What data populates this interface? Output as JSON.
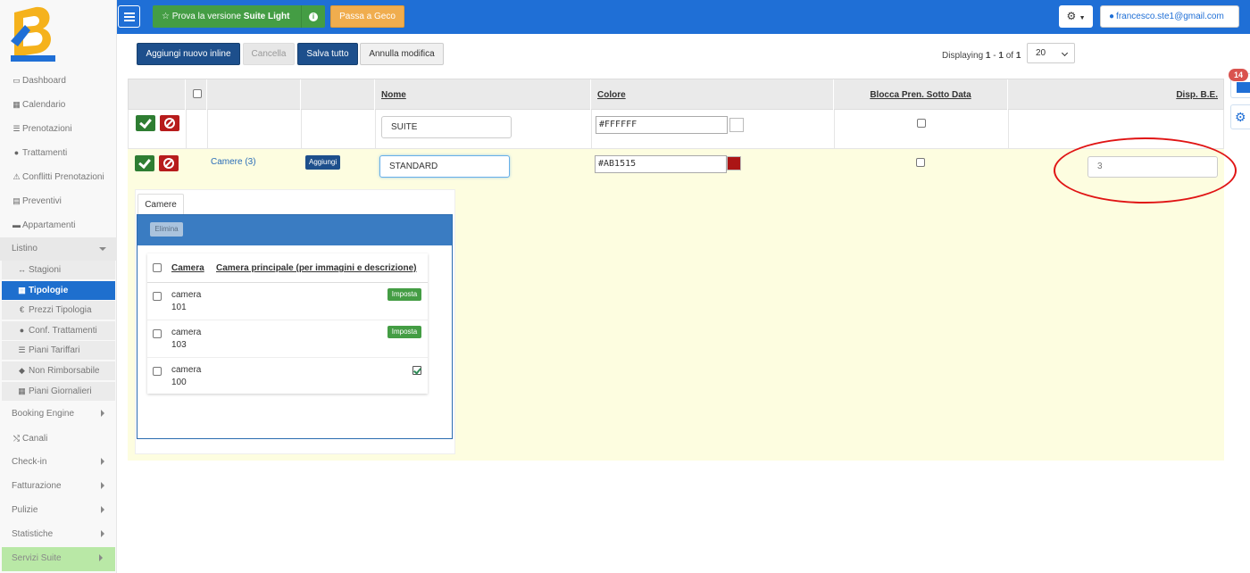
{
  "topbar": {
    "light_prefix": "Prova la versione",
    "light_bold": "Suite Light",
    "geco_label": "Passa a Geco",
    "user_email": "francesco.ste1@gmail.com"
  },
  "sidebar": {
    "items": [
      {
        "label": "Dashboard",
        "icon": "monitor-icon"
      },
      {
        "label": "Calendario",
        "icon": "calendar-icon"
      },
      {
        "label": "Prenotazioni",
        "icon": "list-icon"
      },
      {
        "label": "Trattamenti",
        "icon": "apple-icon"
      },
      {
        "label": "Conflitti Prenotazioni",
        "icon": "warning-icon"
      },
      {
        "label": "Preventivi",
        "icon": "document-icon"
      },
      {
        "label": "Appartamenti",
        "icon": "bed-icon"
      }
    ],
    "listino": "Listino",
    "sub_items": [
      {
        "label": "Stagioni"
      },
      {
        "label": "Tipologie"
      },
      {
        "label": "Prezzi Tipologia"
      },
      {
        "label": "Conf. Trattamenti"
      },
      {
        "label": "Piani Tariffari"
      },
      {
        "label": "Non Rimborsabile"
      },
      {
        "label": "Piani Giornalieri"
      }
    ],
    "bottom_items": [
      {
        "label": "Booking Engine"
      },
      {
        "label": "Canali"
      },
      {
        "label": "Check-in"
      },
      {
        "label": "Fatturazione"
      },
      {
        "label": "Pulizie"
      },
      {
        "label": "Statistiche"
      },
      {
        "label": "Servizi Suite"
      }
    ]
  },
  "toolbar": {
    "add_inline": "Aggiungi nuovo inline",
    "cancel": "Cancella",
    "save_all": "Salva tutto",
    "undo": "Annulla modifica",
    "displaying_prefix": "Displaying",
    "range_start": "1",
    "range_sep": "-",
    "range_end": "1",
    "of_label": "of",
    "total": "1",
    "page_size": "20"
  },
  "table": {
    "headers": {
      "nome": "Nome",
      "colore": "Colore",
      "blocca": "Blocca Pren. Sotto Data",
      "disp": "Disp. B.E."
    },
    "rows": [
      {
        "nome": "SUITE",
        "colore": "#FFFFFF",
        "swatch": "#FFFFFF",
        "disp": ""
      },
      {
        "nome": "STANDARD",
        "colore": "#AB1515",
        "swatch": "#AB1515",
        "camere_link": "Camere (3)",
        "aggiungi": "Aggiungi",
        "disp": "3"
      }
    ]
  },
  "subpanel": {
    "tab": "Camere",
    "elimina": "Elimina",
    "col_camera": "Camera",
    "col_principale": "Camera principale (per immagini e descrizione)",
    "rows": [
      {
        "line1": "camera",
        "line2": "101",
        "action": "Imposta"
      },
      {
        "line1": "camera",
        "line2": "103",
        "action": "Imposta"
      },
      {
        "line1": "camera",
        "line2": "100"
      }
    ]
  },
  "notifications": {
    "count": "14"
  },
  "colors": {
    "primary": "#1f6fd6",
    "accent_green": "#449d44",
    "accent_orange": "#f0ad4e",
    "active_row": "#fdfde0"
  }
}
